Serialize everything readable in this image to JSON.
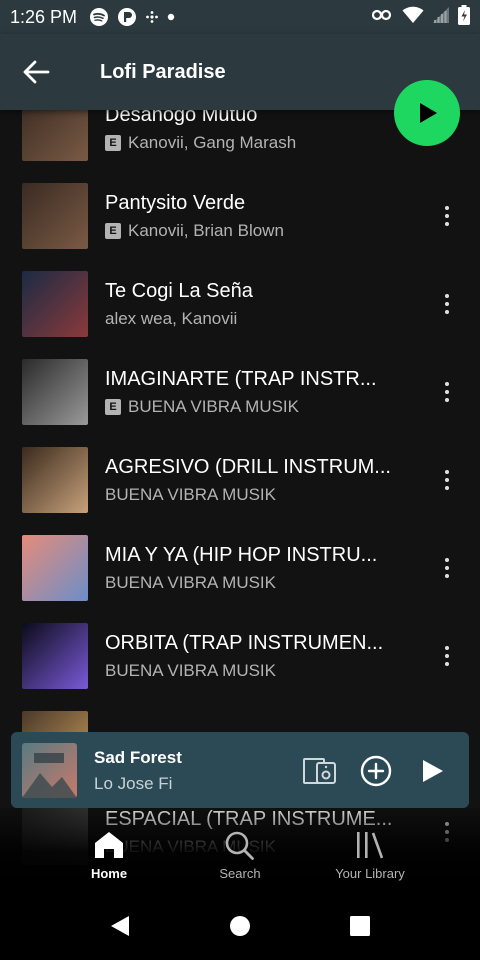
{
  "status_bar": {
    "time": "1:26 PM",
    "left_icons": [
      "spotify-icon",
      "ring-app-icon",
      "pinwheel-icon",
      "dot-icon"
    ],
    "right_icons": [
      "vpn-key-icon",
      "wifi-icon",
      "signal-icon",
      "battery-icon"
    ]
  },
  "header": {
    "title": "Lofi Paradise"
  },
  "tracks": [
    {
      "title": "Desahogo Mutuo",
      "artists": "Kanovii, Gang Marash",
      "explicit": true,
      "cover_colors": [
        "#3a2b22",
        "#7a5a45"
      ]
    },
    {
      "title": "Pantysito Verde",
      "artists": "Kanovii, Brian Blown",
      "explicit": true,
      "cover_colors": [
        "#3a2b22",
        "#7a5a45"
      ]
    },
    {
      "title": "Te Cogi La Seña",
      "artists": "alex wea, Kanovii",
      "explicit": false,
      "cover_colors": [
        "#1b2a44",
        "#8a3a3a"
      ]
    },
    {
      "title": "IMAGINARTE (TRAP INSTR...",
      "artists": "BUENA VIBRA MUSIK",
      "explicit": true,
      "cover_colors": [
        "#2a2a2a",
        "#9a9a9a"
      ]
    },
    {
      "title": "AGRESIVO (DRILL INSTRUM...",
      "artists": "BUENA VIBRA MUSIK",
      "explicit": false,
      "cover_colors": [
        "#3b2a1e",
        "#c7a27a"
      ]
    },
    {
      "title": "MIA Y YA (HIP HOP INSTRU...",
      "artists": "BUENA VIBRA MUSIK",
      "explicit": false,
      "cover_colors": [
        "#e58c7a",
        "#6b8ec9"
      ]
    },
    {
      "title": "ORBITA (TRAP INSTRUMEN...",
      "artists": "BUENA VIBRA MUSIK",
      "explicit": false,
      "cover_colors": [
        "#0b0b1a",
        "#7a5ad8"
      ]
    },
    {
      "title": "",
      "artists": "",
      "explicit": false,
      "cover_colors": [
        "#4a3a2a",
        "#c89a5a"
      ]
    },
    {
      "title": "ESPACIAL (TRAP INSTRUME...",
      "artists": "BUENA VIBRA MUSIK",
      "explicit": false,
      "cover_colors": [
        "#1c1c1c",
        "#4a4a4a"
      ]
    }
  ],
  "explicit_label": "E",
  "mini_player": {
    "title": "Sad Forest",
    "artist": "Lo Jose Fi",
    "controls": [
      "connect-device-icon",
      "add-icon",
      "play-icon"
    ]
  },
  "bottom_nav": {
    "items": [
      {
        "label": "Home",
        "icon": "home-icon",
        "active": true
      },
      {
        "label": "Search",
        "icon": "search-icon",
        "active": false
      },
      {
        "label": "Your Library",
        "icon": "library-icon",
        "active": false
      }
    ]
  },
  "colors": {
    "accent": "#1ed760",
    "header_bg": "#2c3a40",
    "mini_player_bg": "#2c4a56",
    "list_bg": "#121212"
  }
}
